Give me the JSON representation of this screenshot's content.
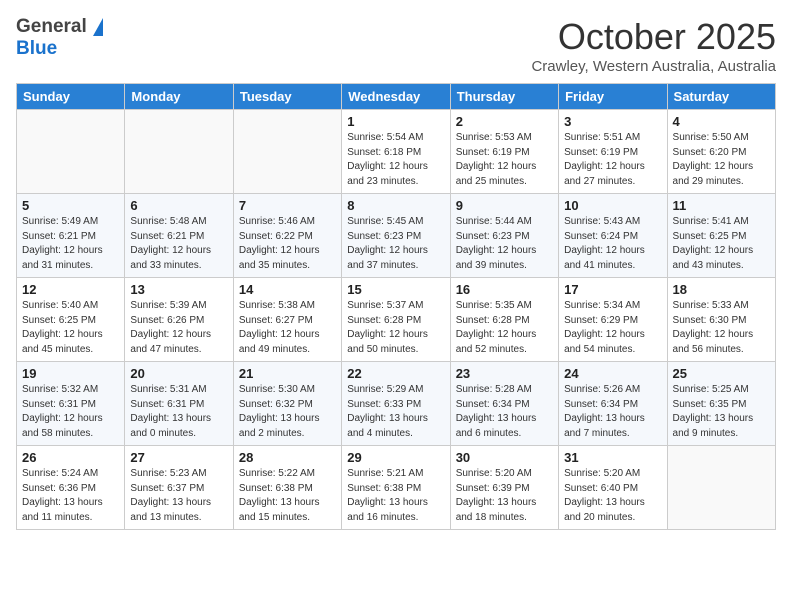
{
  "header": {
    "logo_general": "General",
    "logo_blue": "Blue",
    "month": "October 2025",
    "location": "Crawley, Western Australia, Australia"
  },
  "weekdays": [
    "Sunday",
    "Monday",
    "Tuesday",
    "Wednesday",
    "Thursday",
    "Friday",
    "Saturday"
  ],
  "weeks": [
    [
      {
        "day": "",
        "info": ""
      },
      {
        "day": "",
        "info": ""
      },
      {
        "day": "",
        "info": ""
      },
      {
        "day": "1",
        "info": "Sunrise: 5:54 AM\nSunset: 6:18 PM\nDaylight: 12 hours\nand 23 minutes."
      },
      {
        "day": "2",
        "info": "Sunrise: 5:53 AM\nSunset: 6:19 PM\nDaylight: 12 hours\nand 25 minutes."
      },
      {
        "day": "3",
        "info": "Sunrise: 5:51 AM\nSunset: 6:19 PM\nDaylight: 12 hours\nand 27 minutes."
      },
      {
        "day": "4",
        "info": "Sunrise: 5:50 AM\nSunset: 6:20 PM\nDaylight: 12 hours\nand 29 minutes."
      }
    ],
    [
      {
        "day": "5",
        "info": "Sunrise: 5:49 AM\nSunset: 6:21 PM\nDaylight: 12 hours\nand 31 minutes."
      },
      {
        "day": "6",
        "info": "Sunrise: 5:48 AM\nSunset: 6:21 PM\nDaylight: 12 hours\nand 33 minutes."
      },
      {
        "day": "7",
        "info": "Sunrise: 5:46 AM\nSunset: 6:22 PM\nDaylight: 12 hours\nand 35 minutes."
      },
      {
        "day": "8",
        "info": "Sunrise: 5:45 AM\nSunset: 6:23 PM\nDaylight: 12 hours\nand 37 minutes."
      },
      {
        "day": "9",
        "info": "Sunrise: 5:44 AM\nSunset: 6:23 PM\nDaylight: 12 hours\nand 39 minutes."
      },
      {
        "day": "10",
        "info": "Sunrise: 5:43 AM\nSunset: 6:24 PM\nDaylight: 12 hours\nand 41 minutes."
      },
      {
        "day": "11",
        "info": "Sunrise: 5:41 AM\nSunset: 6:25 PM\nDaylight: 12 hours\nand 43 minutes."
      }
    ],
    [
      {
        "day": "12",
        "info": "Sunrise: 5:40 AM\nSunset: 6:25 PM\nDaylight: 12 hours\nand 45 minutes."
      },
      {
        "day": "13",
        "info": "Sunrise: 5:39 AM\nSunset: 6:26 PM\nDaylight: 12 hours\nand 47 minutes."
      },
      {
        "day": "14",
        "info": "Sunrise: 5:38 AM\nSunset: 6:27 PM\nDaylight: 12 hours\nand 49 minutes."
      },
      {
        "day": "15",
        "info": "Sunrise: 5:37 AM\nSunset: 6:28 PM\nDaylight: 12 hours\nand 50 minutes."
      },
      {
        "day": "16",
        "info": "Sunrise: 5:35 AM\nSunset: 6:28 PM\nDaylight: 12 hours\nand 52 minutes."
      },
      {
        "day": "17",
        "info": "Sunrise: 5:34 AM\nSunset: 6:29 PM\nDaylight: 12 hours\nand 54 minutes."
      },
      {
        "day": "18",
        "info": "Sunrise: 5:33 AM\nSunset: 6:30 PM\nDaylight: 12 hours\nand 56 minutes."
      }
    ],
    [
      {
        "day": "19",
        "info": "Sunrise: 5:32 AM\nSunset: 6:31 PM\nDaylight: 12 hours\nand 58 minutes."
      },
      {
        "day": "20",
        "info": "Sunrise: 5:31 AM\nSunset: 6:31 PM\nDaylight: 13 hours\nand 0 minutes."
      },
      {
        "day": "21",
        "info": "Sunrise: 5:30 AM\nSunset: 6:32 PM\nDaylight: 13 hours\nand 2 minutes."
      },
      {
        "day": "22",
        "info": "Sunrise: 5:29 AM\nSunset: 6:33 PM\nDaylight: 13 hours\nand 4 minutes."
      },
      {
        "day": "23",
        "info": "Sunrise: 5:28 AM\nSunset: 6:34 PM\nDaylight: 13 hours\nand 6 minutes."
      },
      {
        "day": "24",
        "info": "Sunrise: 5:26 AM\nSunset: 6:34 PM\nDaylight: 13 hours\nand 7 minutes."
      },
      {
        "day": "25",
        "info": "Sunrise: 5:25 AM\nSunset: 6:35 PM\nDaylight: 13 hours\nand 9 minutes."
      }
    ],
    [
      {
        "day": "26",
        "info": "Sunrise: 5:24 AM\nSunset: 6:36 PM\nDaylight: 13 hours\nand 11 minutes."
      },
      {
        "day": "27",
        "info": "Sunrise: 5:23 AM\nSunset: 6:37 PM\nDaylight: 13 hours\nand 13 minutes."
      },
      {
        "day": "28",
        "info": "Sunrise: 5:22 AM\nSunset: 6:38 PM\nDaylight: 13 hours\nand 15 minutes."
      },
      {
        "day": "29",
        "info": "Sunrise: 5:21 AM\nSunset: 6:38 PM\nDaylight: 13 hours\nand 16 minutes."
      },
      {
        "day": "30",
        "info": "Sunrise: 5:20 AM\nSunset: 6:39 PM\nDaylight: 13 hours\nand 18 minutes."
      },
      {
        "day": "31",
        "info": "Sunrise: 5:20 AM\nSunset: 6:40 PM\nDaylight: 13 hours\nand 20 minutes."
      },
      {
        "day": "",
        "info": ""
      }
    ]
  ]
}
